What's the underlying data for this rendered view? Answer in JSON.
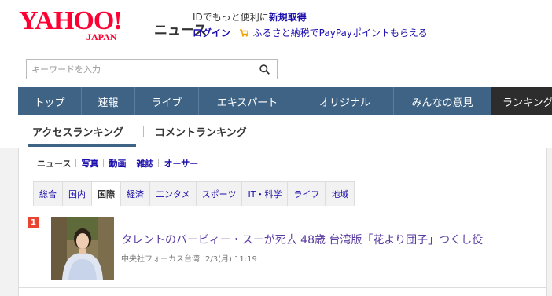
{
  "header": {
    "logo_main": "YAHOO!",
    "logo_sub": "JAPAN",
    "logo_news": "ニュース",
    "message_prefix": "IDでもっと便利に",
    "message_link": "新規取得",
    "login": "ログイン",
    "furusato": "ふるさと納税でPayPayポイントもらえる"
  },
  "search": {
    "placeholder": "キーワードを入力"
  },
  "nav": [
    {
      "label": "トップ"
    },
    {
      "label": "速報"
    },
    {
      "label": "ライブ"
    },
    {
      "label": "エキスパート"
    },
    {
      "label": "オリジナル"
    },
    {
      "label": "みんなの意見"
    },
    {
      "label": "ランキング",
      "active": true
    }
  ],
  "subtabs": {
    "access": "アクセスランキング",
    "comment": "コメントランキング"
  },
  "categories": [
    "ニュース",
    "写真",
    "動画",
    "雑誌",
    "オーサー"
  ],
  "tabs": [
    "総合",
    "国内",
    "国際",
    "経済",
    "エンタメ",
    "スポーツ",
    "IT・科学",
    "ライフ",
    "地域"
  ],
  "active_tab": "国際",
  "article": {
    "rank": "1",
    "headline": "タレントのバービィー・スーが死去 48歳 台湾版「花より団子」つくし役",
    "source": "中央社フォーカス台湾",
    "datetime": "2/3(月) 11:19"
  },
  "colors": {
    "brand": "#ff0033",
    "nav": "#3f6385",
    "nav_active": "#2d2d2d",
    "link": "#1a0dab",
    "visited": "#5a3da0",
    "rank_badge": "#e8442f"
  }
}
